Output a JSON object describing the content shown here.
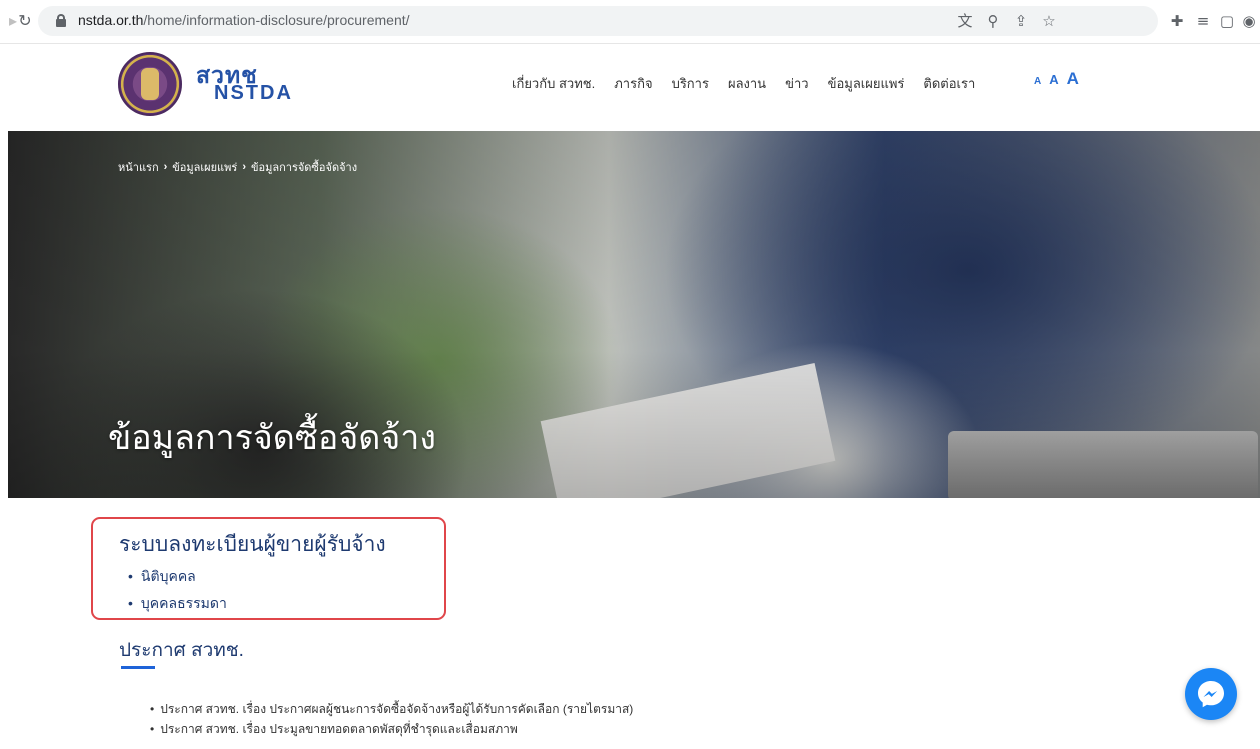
{
  "browser": {
    "url_host": "nstda.or.th",
    "url_path": "/home/information-disclosure/procurement/"
  },
  "site": {
    "logo_th": "สวทช",
    "logo_en": "NSTDA",
    "nav": [
      "เกี่ยวกับ สวทช.",
      "ภารกิจ",
      "บริการ",
      "ผลงาน",
      "ข่าว",
      "ข้อมูลเผยแพร่",
      "ติดต่อเรา"
    ],
    "font_sizes": [
      "A",
      "A",
      "A"
    ],
    "accent_color": "#2b6fd3"
  },
  "hero": {
    "breadcrumb": [
      "หน้าแรก",
      "ข้อมูลเผยแพร่",
      "ข้อมูลการจัดซื้อจัดจ้าง"
    ],
    "title": "ข้อมูลการจัดซื้อจัดจ้าง"
  },
  "register": {
    "title": "ระบบลงทะเบียนผู้ขายผู้รับจ้าง",
    "links": [
      "นิติบุคคล",
      "บุคคลธรรมดา"
    ]
  },
  "announce": {
    "title": "ประกาศ สวทช.",
    "items": [
      "ประกาศ สวทช. เรื่อง ประกาศผลผู้ชนะการจัดซื้อจัดจ้างหรือผู้ได้รับการคัดเลือก (รายไตรมาส)",
      "ประกาศ สวทช. เรื่อง ประมูลขายทอดตลาดพัสดุที่ชำรุดและเสื่อมสภาพ"
    ]
  }
}
